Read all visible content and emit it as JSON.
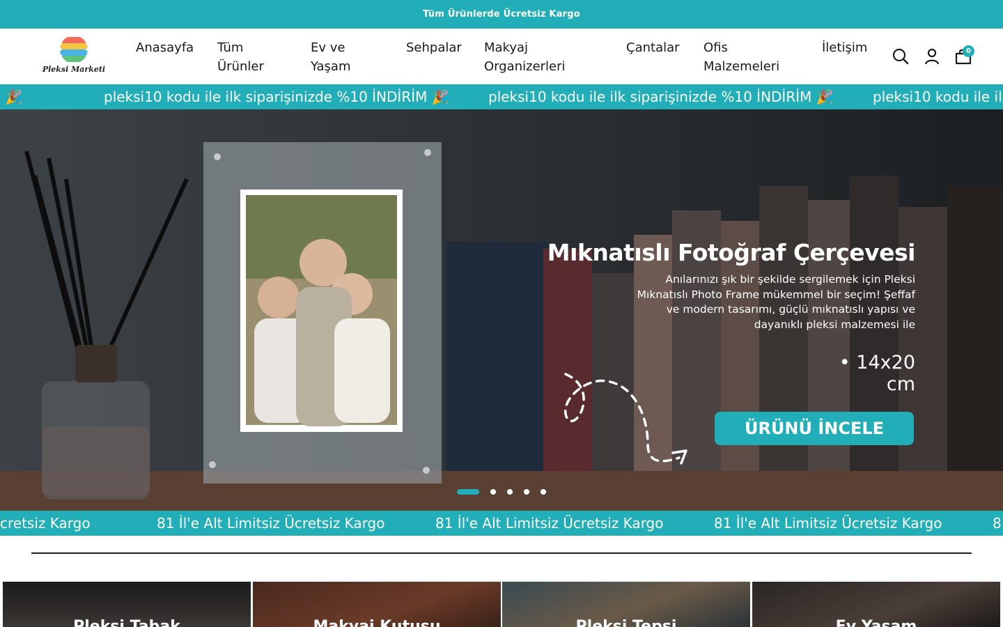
{
  "announcement": "Tüm Ürünlerde Ücretsiz Kargo",
  "brand": {
    "name": "Pleksi Marketi"
  },
  "nav": [
    {
      "label": "Anasayfa"
    },
    {
      "label": "Tüm Ürünler"
    },
    {
      "label": "Ev ve Yaşam"
    },
    {
      "label": "Sehpalar"
    },
    {
      "label": "Makyaj Organizerleri"
    },
    {
      "label": "Çantalar"
    },
    {
      "label": "Ofis Malzemeleri"
    },
    {
      "label": "İletişim"
    }
  ],
  "header_icons": {
    "search": "search-icon",
    "account": "user-icon",
    "cart": "shopping-bag-icon",
    "cart_count": "0"
  },
  "promo_marquee": {
    "text": "pleksi10 kodu ile ilk siparişinizde %10 İNDİRİM 🎉",
    "fragment_left": "İM 🎉",
    "fragment_right": "pleksi10 kodu ile ilk"
  },
  "hero": {
    "title": "Mıknatıslı Fotoğraf Çerçevesi",
    "description": "Anılarınızı şık bir şekilde sergilemek için Pleksi Mıknatıslı Photo Frame mükemmel bir seçim! Şeffaf ve modern tasarımı, güçlü mıknatıslı yapısı ve dayanıklı pleksi malzemesi ile",
    "size": "• 14x20 cm",
    "cta": "ÜRÜNÜ İNCELE",
    "slides_total": 5,
    "active_slide": 1
  },
  "shipping_marquee": {
    "text": "81 İl'e Alt Limitsiz Ücretsiz Kargo",
    "fragment_left": "cretsiz Kargo",
    "fragment_right": "81"
  },
  "categories": [
    {
      "label": "Pleksi Tabak"
    },
    {
      "label": "Makyaj Kutusu"
    },
    {
      "label": "Pleksi Tepsi"
    },
    {
      "label": "Ev Yaşam"
    }
  ],
  "colors": {
    "brand_teal": "#22aeb8",
    "text_dark": "#1a1a1a"
  }
}
